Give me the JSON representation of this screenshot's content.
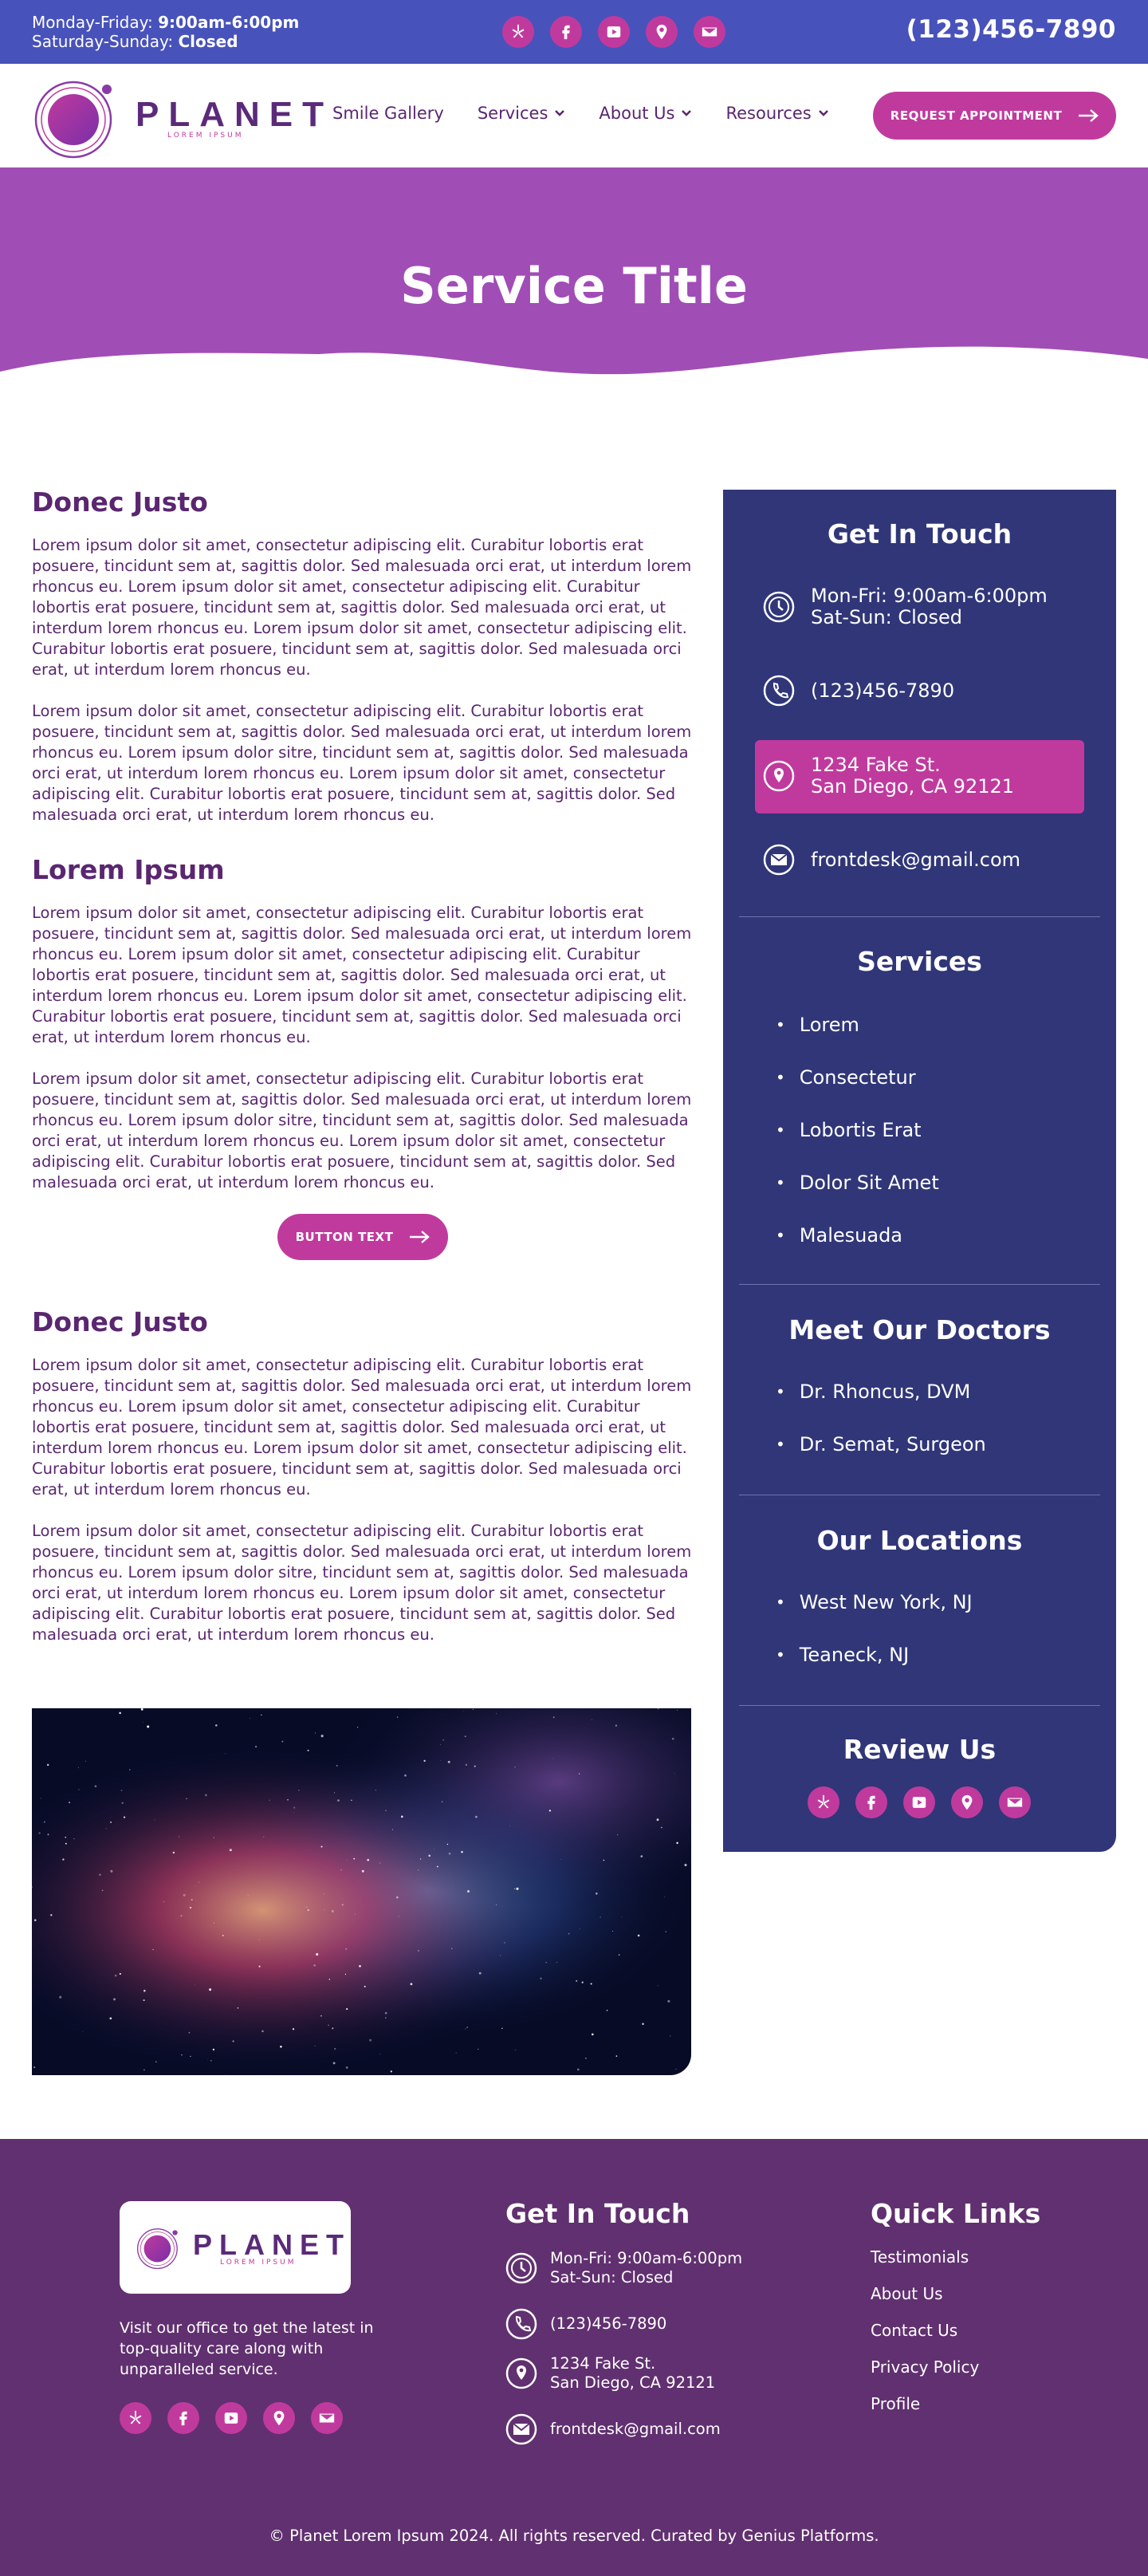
{
  "topbar": {
    "weekday_label": "Monday-Friday:",
    "weekday_hours": "9:00am-6:00pm",
    "weekend_label": "Saturday-Sunday:",
    "weekend_hours": "Closed",
    "phone": "(123)456-7890",
    "social_icons": [
      "yelp-icon",
      "facebook-icon",
      "youtube-icon",
      "map-pin-icon",
      "email-icon"
    ]
  },
  "header": {
    "logo_name": "PLANET",
    "logo_tagline": "LOREM IPSUM",
    "nav": [
      {
        "label": "Smile Gallery",
        "dropdown": false
      },
      {
        "label": "Services",
        "dropdown": true
      },
      {
        "label": "About Us",
        "dropdown": true
      },
      {
        "label": "Resources",
        "dropdown": true
      }
    ],
    "cta_label": "REQUEST APPOINTMENT"
  },
  "hero": {
    "title": "Service Title"
  },
  "content": {
    "section1": {
      "heading": "Donec Justo",
      "p1": "Lorem ipsum dolor sit amet, consectetur adipiscing elit. Curabitur lobortis erat posuere, tincidunt sem at, sagittis dolor. Sed malesuada orci erat, ut interdum lorem rhoncus eu. Lorem ipsum dolor sit amet, consectetur adipiscing elit. Curabitur lobortis erat posuere, tincidunt sem at, sagittis dolor. Sed malesuada orci erat, ut interdum lorem rhoncus eu. Lorem ipsum dolor sit amet, consectetur adipiscing elit. Curabitur lobortis erat posuere, tincidunt sem at, sagittis dolor. Sed malesuada orci erat, ut interdum lorem rhoncus eu.",
      "p2": "Lorem ipsum dolor sit amet, consectetur adipiscing elit. Curabitur lobortis erat posuere, tincidunt sem at, sagittis dolor. Sed malesuada orci erat, ut interdum lorem rhoncus eu. Lorem ipsum dolor sitre, tincidunt sem at, sagittis dolor. Sed malesuada orci erat, ut interdum lorem rhoncus eu. Lorem ipsum dolor sit amet, consectetur adipiscing elit. Curabitur lobortis erat posuere, tincidunt sem at, sagittis dolor. Sed malesuada orci erat, ut interdum lorem rhoncus eu."
    },
    "section2": {
      "heading": "Lorem Ipsum",
      "p1": "Lorem ipsum dolor sit amet, consectetur adipiscing elit. Curabitur lobortis erat posuere, tincidunt sem at, sagittis dolor. Sed malesuada orci erat, ut interdum lorem rhoncus eu. Lorem ipsum dolor sit amet, consectetur adipiscing elit. Curabitur lobortis erat posuere, tincidunt sem at, sagittis dolor. Sed malesuada orci erat, ut interdum lorem rhoncus eu. Lorem ipsum dolor sit amet, consectetur adipiscing elit. Curabitur lobortis erat posuere, tincidunt sem at, sagittis dolor. Sed malesuada orci erat, ut interdum lorem rhoncus eu.",
      "p2": "Lorem ipsum dolor sit amet, consectetur adipiscing elit. Curabitur lobortis erat posuere, tincidunt sem at, sagittis dolor. Sed malesuada orci erat, ut interdum lorem rhoncus eu. Lorem ipsum dolor sitre, tincidunt sem at, sagittis dolor. Sed malesuada orci erat, ut interdum lorem rhoncus eu. Lorem ipsum dolor sit amet, consectetur adipiscing elit. Curabitur lobortis erat posuere, tincidunt sem at, sagittis dolor. Sed malesuada orci erat, ut interdum lorem rhoncus eu.",
      "button_label": "BUTTON TEXT"
    },
    "section3": {
      "heading": "Donec Justo",
      "p1": "Lorem ipsum dolor sit amet, consectetur adipiscing elit. Curabitur lobortis erat posuere, tincidunt sem at, sagittis dolor. Sed malesuada orci erat, ut interdum lorem rhoncus eu. Lorem ipsum dolor sit amet, consectetur adipiscing elit. Curabitur lobortis erat posuere, tincidunt sem at, sagittis dolor. Sed malesuada orci erat, ut interdum lorem rhoncus eu. Lorem ipsum dolor sit amet, consectetur adipiscing elit. Curabitur lobortis erat posuere, tincidunt sem at, sagittis dolor. Sed malesuada orci erat, ut interdum lorem rhoncus eu.",
      "p2": "Lorem ipsum dolor sit amet, consectetur adipiscing elit. Curabitur lobortis erat posuere, tincidunt sem at, sagittis dolor. Sed malesuada orci erat, ut interdum lorem rhoncus eu. Lorem ipsum dolor sitre, tincidunt sem at, sagittis dolor. Sed malesuada orci erat, ut interdum lorem rhoncus eu. Lorem ipsum dolor sit amet, consectetur adipiscing elit. Curabitur lobortis erat posuere, tincidunt sem at, sagittis dolor. Sed malesuada orci erat, ut interdum lorem rhoncus eu."
    }
  },
  "sidebar": {
    "contact_heading": "Get In Touch",
    "hours_line1": "Mon-Fri: 9:00am-6:00pm",
    "hours_line2": "Sat-Sun: Closed",
    "phone": "(123)456-7890",
    "address_line1": "1234 Fake St.",
    "address_line2": "San Diego, CA 92121",
    "email": "frontdesk@gmail.com",
    "services_heading": "Services",
    "services": [
      "Lorem",
      "Consectetur",
      "Lobortis Erat",
      "Dolor Sit Amet",
      "Malesuada"
    ],
    "doctors_heading": "Meet Our Doctors",
    "doctors": [
      "Dr.  Rhoncus, DVM",
      "Dr. Semat, Surgeon"
    ],
    "locations_heading": "Our Locations",
    "locations": [
      "West New York, NJ",
      "Teaneck, NJ"
    ],
    "review_heading": "Review Us"
  },
  "footer": {
    "description": "Visit our office to get the latest in top-quality care along with unparalleled service.",
    "contact_heading": "Get In Touch",
    "hours_line1": "Mon-Fri: 9:00am-6:00pm",
    "hours_line2": "Sat-Sun: Closed",
    "phone": "(123)456-7890",
    "address_line1": "1234 Fake St.",
    "address_line2": "San Diego, CA 92121",
    "email": "frontdesk@gmail.com",
    "links_heading": "Quick Links",
    "links": [
      "Testimonials",
      "About Us",
      "Contact Us",
      "Privacy Policy",
      "Profile"
    ],
    "copyright": "© Planet Lorem Ipsum 2024. All rights reserved. Curated by Genius Platforms."
  },
  "colors": {
    "topbar": "#4852bb",
    "accent": "#c03a9e",
    "hero": "#a14db6",
    "sidebar": "#303678",
    "footer": "#613070",
    "text": "#5a2670"
  }
}
